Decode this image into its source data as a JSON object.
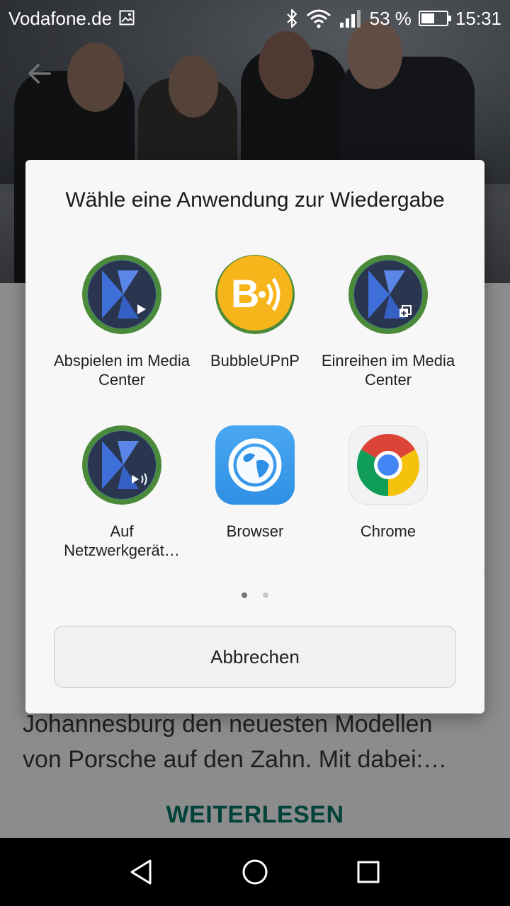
{
  "status_bar": {
    "carrier": "Vodafone.de",
    "battery": "53 %",
    "time": "15:31",
    "battery_level": 0.53
  },
  "background_app": {
    "article_text_line1": "Johannesburg den neuesten Modellen",
    "article_text_line2": "von Porsche auf den Zahn. Mit dabei:…",
    "read_more_label": "WEITERLESEN"
  },
  "dialog": {
    "title": "Wähle eine Anwendung zur Wiedergabe",
    "apps": [
      {
        "label": "Abspielen im Media Center",
        "icon": "kodi-play-icon"
      },
      {
        "label": "BubbleUPnP",
        "icon": "bubbleupnp-icon"
      },
      {
        "label": "Einreihen im Media Center",
        "icon": "kodi-queue-icon"
      },
      {
        "label": "Auf Netzwerkgerät…",
        "icon": "kodi-cast-icon"
      },
      {
        "label": "Browser",
        "icon": "browser-globe-icon"
      },
      {
        "label": "Chrome",
        "icon": "chrome-icon"
      }
    ],
    "page_count": 2,
    "current_page": 1,
    "cancel_label": "Abbrechen"
  },
  "colors": {
    "accent_green": "#00796b",
    "kodi_blue": "#3f6fd8",
    "bubble_yellow": "#f6b51a",
    "browser_blue": "#2e93e8"
  }
}
